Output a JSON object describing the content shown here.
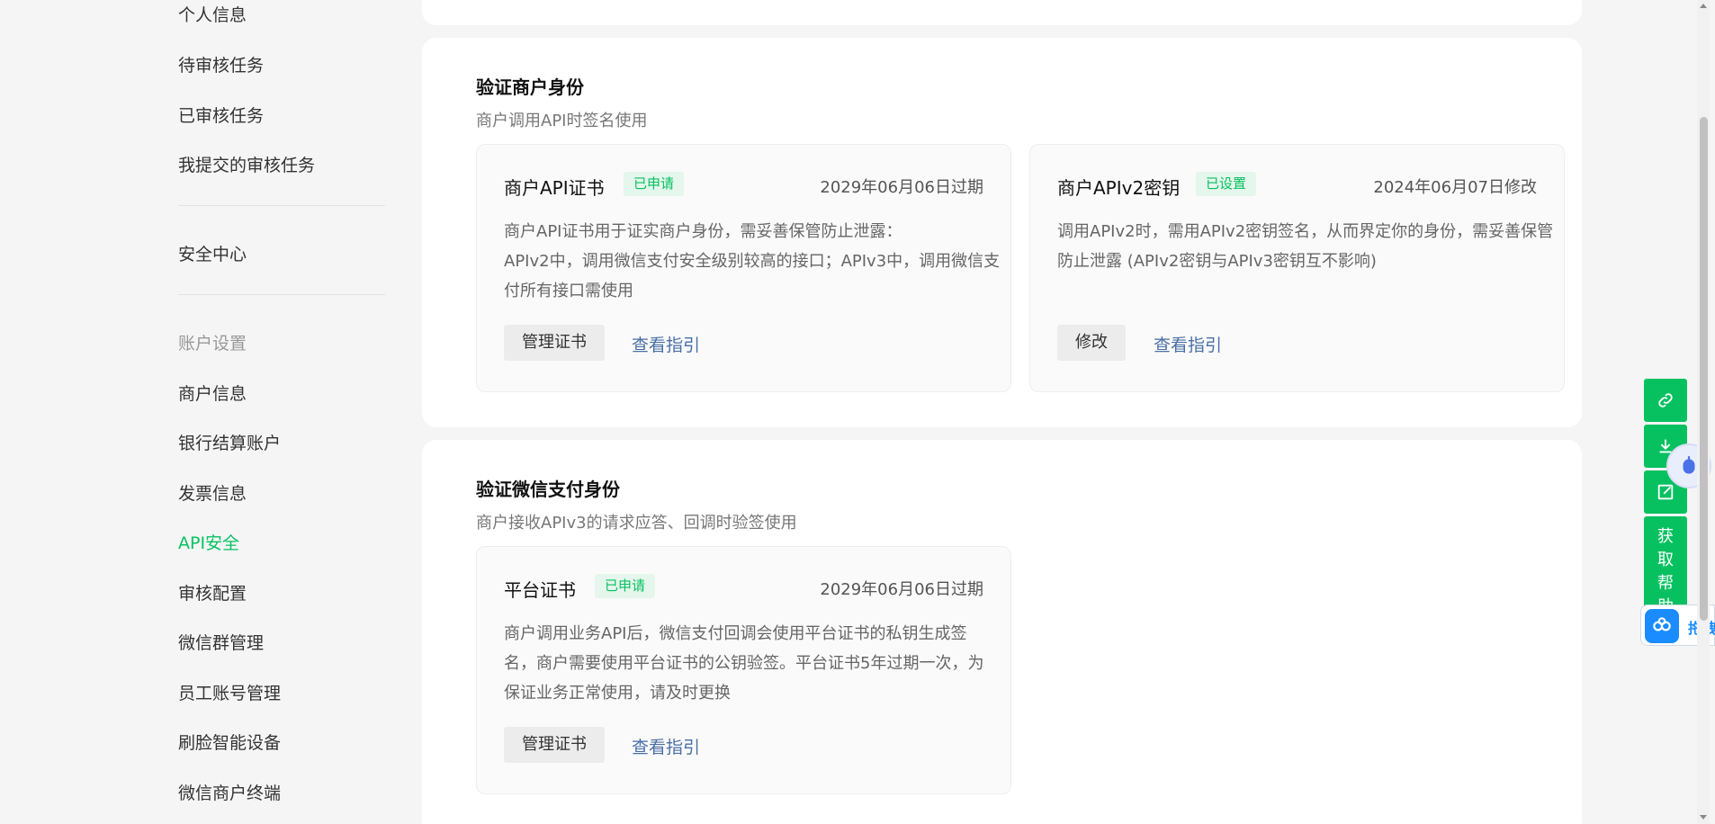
{
  "sidebar": {
    "items_top": [
      "个人信息",
      "待审核任务",
      "已审核任务",
      "我提交的审核任务"
    ],
    "security_center": "安全中心",
    "group_label": "账户设置",
    "items_account": [
      "商户信息",
      "银行结算账户",
      "发票信息",
      "API安全",
      "审核配置",
      "微信群管理",
      "员工账号管理",
      "刷脸智能设备",
      "微信商户终端"
    ],
    "active_item": "API安全"
  },
  "section_merchant": {
    "title": "验证商户身份",
    "subtitle": "商户调用API时签名使用",
    "card_cert": {
      "title": "商户API证书",
      "badge": "已申请",
      "date": "2029年06月06日过期",
      "desc_line1": "商户API证书用于证实商户身份，需妥善保管防止泄露：",
      "desc_line2": "APIv2中，调用微信支付安全级别较高的接口；APIv3中，调用微信支",
      "desc_line3": "付所有接口需使用",
      "button": "管理证书",
      "link": "查看指引"
    },
    "card_key": {
      "title": "商户APIv2密钥",
      "badge": "已设置",
      "date": "2024年06月07日修改",
      "desc_line1": "调用APIv2时，需用APIv2密钥签名，从而界定你的身份，需妥善保管",
      "desc_line2": "防止泄露 (APIv2密钥与APIv3密钥互不影响)",
      "button": "修改",
      "link": "查看指引"
    }
  },
  "section_wechat": {
    "title": "验证微信支付身份",
    "subtitle": "商户接收APIv3的请求应答、回调时验签使用",
    "card_platform": {
      "title": "平台证书",
      "badge": "已申请",
      "date": "2029年06月06日过期",
      "desc_line1": "商户调用业务API后，微信支付回调会使用平台证书的私钥生成签",
      "desc_line2": "名，商户需要使用平台证书的公钥验签。平台证书5年过期一次，为",
      "desc_line3": "保证业务正常使用，请及时更换",
      "button": "管理证书",
      "link": "查看指引"
    }
  },
  "float_bar": {
    "help_label": "获取帮助",
    "icons": [
      "link-icon",
      "download-icon",
      "edit-icon"
    ],
    "drag_label": "拖拽"
  },
  "colors": {
    "accent": "#07c160",
    "link": "#4a6fa5",
    "badge_bg": "#e5f6ec"
  }
}
